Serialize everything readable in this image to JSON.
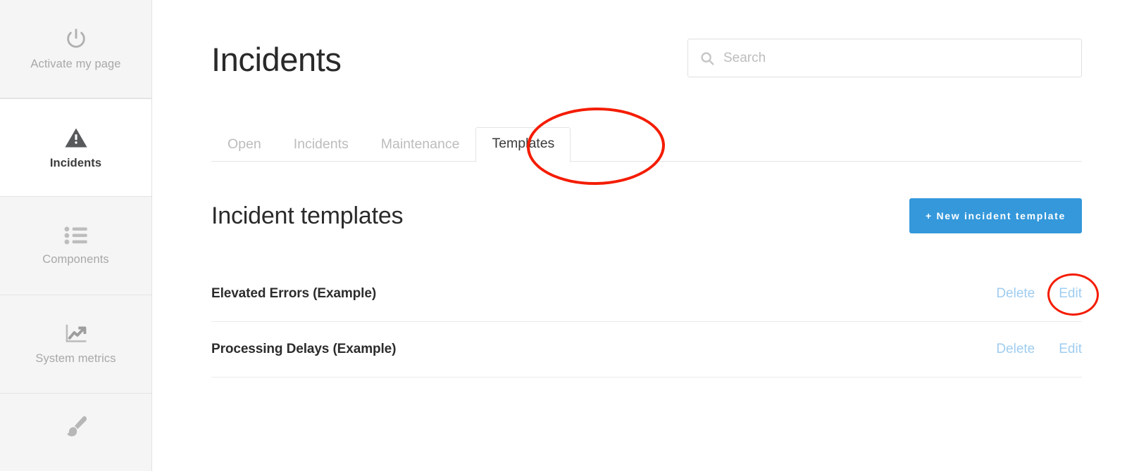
{
  "sidebar": {
    "items": [
      {
        "label": "Activate my page",
        "icon": "power-icon",
        "active": false
      },
      {
        "label": "Incidents",
        "icon": "warning-triangle-icon",
        "active": true
      },
      {
        "label": "Components",
        "icon": "list-icon",
        "active": false
      },
      {
        "label": "System metrics",
        "icon": "chart-trending-up-icon",
        "active": false
      },
      {
        "label": "",
        "icon": "paint-brush-icon",
        "active": false
      }
    ]
  },
  "header": {
    "title": "Incidents"
  },
  "search": {
    "icon": "search-icon",
    "placeholder": "Search",
    "value": ""
  },
  "tabs": [
    {
      "label": "Open",
      "active": false
    },
    {
      "label": "Incidents",
      "active": false
    },
    {
      "label": "Maintenance",
      "active": false
    },
    {
      "label": "Templates",
      "active": true
    }
  ],
  "section": {
    "title": "Incident templates",
    "new_button_label": "+ New incident template",
    "accent_color": "#3498db"
  },
  "templates": [
    {
      "name": "Elevated Errors (Example)",
      "delete_label": "Delete",
      "edit_label": "Edit"
    },
    {
      "name": "Processing Delays (Example)",
      "delete_label": "Delete",
      "edit_label": "Edit"
    }
  ],
  "annotations": [
    {
      "target": "tab-templates",
      "shape": "ellipse",
      "color": "#f41c00"
    },
    {
      "target": "row-0-edit-link",
      "shape": "ellipse",
      "color": "#f41c00"
    }
  ],
  "link_color": "#9fcdf0"
}
